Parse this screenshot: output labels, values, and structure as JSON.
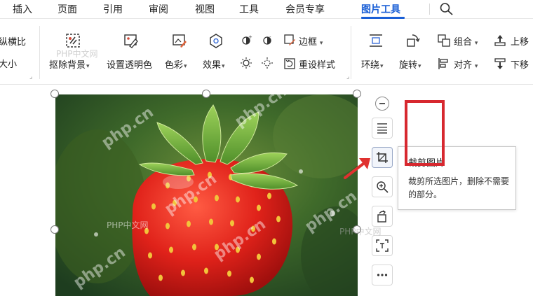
{
  "menu": {
    "items": [
      "插入",
      "页面",
      "引用",
      "审阅",
      "视图",
      "工具",
      "会员专享",
      "图片工具"
    ],
    "active": "图片工具"
  },
  "ribbon": {
    "left_partial": [
      "纵横比",
      "大小"
    ],
    "remove_bg": "抠除背景",
    "set_transparent": "设置透明色",
    "color": "色彩",
    "effects": "效果",
    "border": "边框",
    "reset_style": "重设样式",
    "wrap": "环绕",
    "rotate": "旋转",
    "group": "组合",
    "align": "对齐",
    "bring_forward": "上移",
    "send_backward": "下移"
  },
  "tooltip": {
    "title": "裁剪图片",
    "description": "裁剪所选图片，删除不需要的部分。"
  },
  "watermarks": {
    "site_cn": "PHP中文网",
    "site_url": "php.cn"
  },
  "colors": {
    "accent": "#1a5fd6",
    "highlight_box": "#d7282f",
    "arrow": "#e0312f"
  }
}
